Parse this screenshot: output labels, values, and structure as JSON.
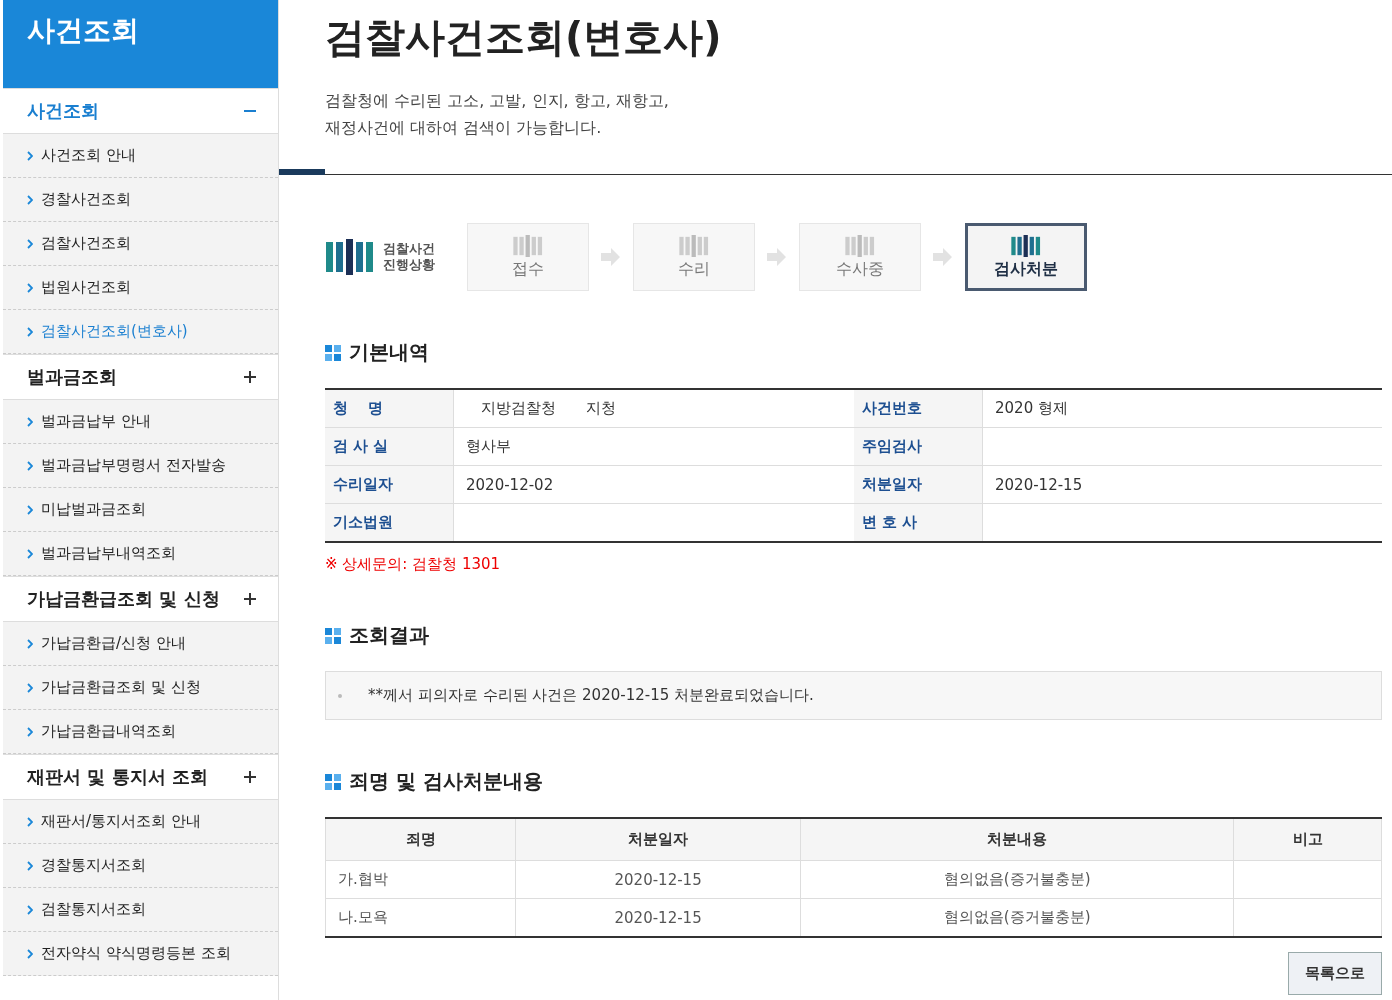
{
  "sidebar": {
    "title": "사건조회",
    "groups": [
      {
        "label": "사건조회",
        "selected": true,
        "expanded": true,
        "items": [
          {
            "label": "사건조회 안내",
            "selected": false
          },
          {
            "label": "경찰사건조회",
            "selected": false
          },
          {
            "label": "검찰사건조회",
            "selected": false
          },
          {
            "label": "법원사건조회",
            "selected": false
          },
          {
            "label": "검찰사건조회(변호사)",
            "selected": true
          }
        ]
      },
      {
        "label": "벌과금조회",
        "selected": false,
        "expanded": false,
        "items": [
          {
            "label": "벌과금납부 안내",
            "selected": false
          },
          {
            "label": "벌과금납부명령서 전자발송",
            "selected": false
          },
          {
            "label": "미납벌과금조회",
            "selected": false
          },
          {
            "label": "벌과금납부내역조회",
            "selected": false
          }
        ]
      },
      {
        "label": "가납금환급조회 및 신청",
        "selected": false,
        "expanded": false,
        "items": [
          {
            "label": "가납금환급/신청 안내",
            "selected": false
          },
          {
            "label": "가납금환급조회 및 신청",
            "selected": false
          },
          {
            "label": "가납금환급내역조회",
            "selected": false
          }
        ]
      },
      {
        "label": "재판서 및 통지서 조회",
        "selected": false,
        "expanded": false,
        "items": [
          {
            "label": "재판서/통지서조회 안내",
            "selected": false
          },
          {
            "label": "경찰통지서조회",
            "selected": false
          },
          {
            "label": "검찰통지서조회",
            "selected": false
          },
          {
            "label": "전자약식 약식명령등본 조회",
            "selected": false
          }
        ]
      }
    ]
  },
  "page": {
    "title": "검찰사건조회(변호사)",
    "description_lines": [
      "검찰청에 수리된 고소, 고발, 인지, 항고, 재항고,",
      "재정사건에 대하여 검색이 가능합니다."
    ]
  },
  "progress": {
    "label_lines": [
      "검찰사건",
      "진행상황"
    ],
    "steps": [
      {
        "label": "접수",
        "selected": false
      },
      {
        "label": "수리",
        "selected": false
      },
      {
        "label": "수사중",
        "selected": false
      },
      {
        "label": "검사처분",
        "selected": true
      }
    ]
  },
  "basic_info": {
    "title": "기본내역",
    "rows": [
      [
        {
          "label": "청　 명",
          "value": "　지방검찰청　　지청"
        },
        {
          "label": "사건번호",
          "value": "2020 형제"
        }
      ],
      [
        {
          "label": "검 사 실",
          "value": "형사부"
        },
        {
          "label": "주임검사"
        }
      ],
      [
        {
          "label": "수리일자",
          "value": "2020-12-02"
        },
        {
          "label": "처분일자",
          "value": "2020-12-15"
        }
      ],
      [
        {
          "label": "기소법원"
        },
        {
          "label": "변 호 사"
        }
      ]
    ],
    "note": "※ 상세문의: 검찰청 1301"
  },
  "result": {
    "title": "조회결과",
    "message": "**께서 피의자로 수리된 사건은 2020-12-15 처분완료되었습니다."
  },
  "charges": {
    "title": "죄명 및 검사처분내용",
    "columns": [
      "죄명",
      "처분일자",
      "처분내용",
      "비고"
    ],
    "rows": [
      [
        "가.협박",
        "2020-12-15",
        "혐의없음(증거불충분)",
        ""
      ],
      [
        "나.모욕",
        "2020-12-15",
        "혐의없음(증거불충분)",
        ""
      ]
    ]
  },
  "buttons": [
    "목록으로"
  ]
}
